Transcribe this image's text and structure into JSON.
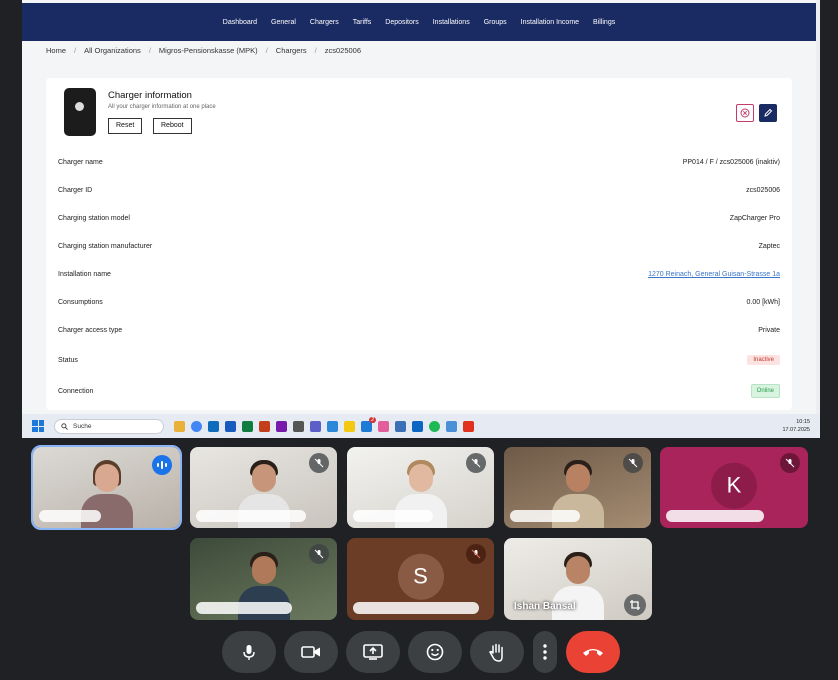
{
  "app": {
    "nav": [
      "Dashboard",
      "General",
      "Chargers",
      "Tariffs",
      "Depositors",
      "Installations",
      "Groups",
      "Installation Income",
      "Billings"
    ],
    "breadcrumbs": [
      "Home",
      "All Organizations",
      "Migros-Pensionskasse (MPK)",
      "Chargers",
      "zcs025006"
    ],
    "breadcrumb_sep": "/",
    "card": {
      "title": "Charger information",
      "subtitle": "All your charger information at one place",
      "reset_label": "Reset",
      "reboot_label": "Reboot"
    },
    "rows": [
      {
        "label": "Charger name",
        "value": "PP014 / F / zcs025006 (inaktiv)"
      },
      {
        "label": "Charger ID",
        "value": "zcs025006"
      },
      {
        "label": "Charging station model",
        "value": "ZapCharger Pro"
      },
      {
        "label": "Charging station manufacturer",
        "value": "Zaptec"
      },
      {
        "label": "Installation name",
        "value": "1270 Reinach, General Guisan-Strasse 1a"
      },
      {
        "label": "Consumptions",
        "value": "0.00 [kWh]"
      },
      {
        "label": "Charger access type",
        "value": "Private"
      },
      {
        "label": "Status",
        "value": "Inactive"
      },
      {
        "label": "Connection",
        "value": "Online"
      }
    ],
    "colors": {
      "navbar": "#1a2a63",
      "link": "#3a76c7",
      "inactive": "#c0392b",
      "online": "#27a04a"
    }
  },
  "taskbar": {
    "search_placeholder": "Suche",
    "time": "10:15",
    "date": "17.07.2025",
    "mail_badge": "2"
  },
  "meeting": {
    "participants": [
      {
        "initial": "",
        "label": ""
      },
      {
        "initial": "",
        "label": ""
      },
      {
        "initial": "",
        "label": ""
      },
      {
        "initial": "",
        "label": ""
      },
      {
        "initial": "K",
        "label": "",
        "color": "#a8245a"
      },
      {
        "initial": "",
        "label": ""
      },
      {
        "initial": "S",
        "label": "",
        "color": "#6b3c26"
      },
      {
        "initial": "",
        "label": "Ishan Bansal"
      }
    ],
    "controls": [
      "mic",
      "camera",
      "present",
      "emoji",
      "raise-hand",
      "more",
      "leave-call"
    ]
  }
}
